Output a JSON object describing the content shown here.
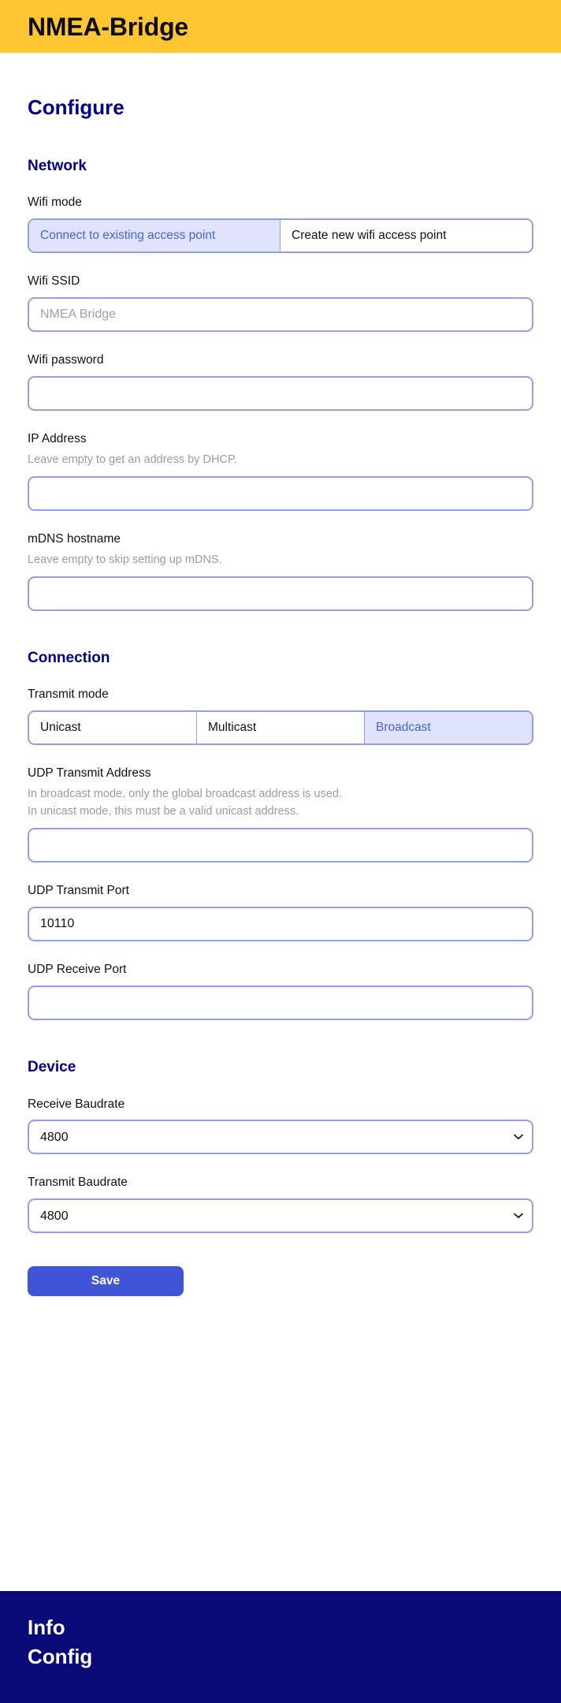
{
  "header": {
    "title": "NMEA-Bridge"
  },
  "main": {
    "page_heading": "Configure",
    "sections": {
      "network": {
        "heading": "Network",
        "wifi_mode": {
          "label": "Wifi mode",
          "options": [
            "Connect to existing access point",
            "Create new wifi access point"
          ],
          "selected": "Connect to existing access point"
        },
        "wifi_ssid": {
          "label": "Wifi SSID",
          "value": "",
          "placeholder": "NMEA Bridge"
        },
        "wifi_password": {
          "label": "Wifi password",
          "value": "",
          "placeholder": ""
        },
        "ip_address": {
          "label": "IP Address",
          "help": "Leave empty to get an address by DHCP.",
          "value": "",
          "placeholder": ""
        },
        "mdns_hostname": {
          "label": "mDNS hostname",
          "help": "Leave empty to skip setting up mDNS.",
          "value": "",
          "placeholder": ""
        }
      },
      "connection": {
        "heading": "Connection",
        "transmit_mode": {
          "label": "Transmit mode",
          "options": [
            "Unicast",
            "Multicast",
            "Broadcast"
          ],
          "selected": "Broadcast"
        },
        "udp_transmit_address": {
          "label": "UDP Transmit Address",
          "help_line1": "In broadcast mode, only the global broadcast address is used.",
          "help_line2": "In unicast mode, this must be a valid unicast address.",
          "value": "",
          "placeholder": ""
        },
        "udp_transmit_port": {
          "label": "UDP Transmit Port",
          "value": "10110",
          "placeholder": ""
        },
        "udp_receive_port": {
          "label": "UDP Receive Port",
          "value": "",
          "placeholder": ""
        }
      },
      "device": {
        "heading": "Device",
        "receive_baudrate": {
          "label": "Receive Baudrate",
          "selected": "4800",
          "icon": "chevron-down-icon"
        },
        "transmit_baudrate": {
          "label": "Transmit Baudrate",
          "selected": "4800",
          "icon": "chevron-down-icon"
        }
      }
    },
    "save_label": "Save"
  },
  "footer": {
    "links": [
      "Info",
      "Config"
    ]
  },
  "colors": {
    "header_background": "#ffc633",
    "heading_blue": "#00008b",
    "input_border": "#8e9fef",
    "segment_selected_background": "#dfe3fd",
    "segment_selected_text": "#4a63d8",
    "save_button": "#4054d8",
    "footer_background": "#0a0a78",
    "help_text": "#9a9aaa"
  }
}
